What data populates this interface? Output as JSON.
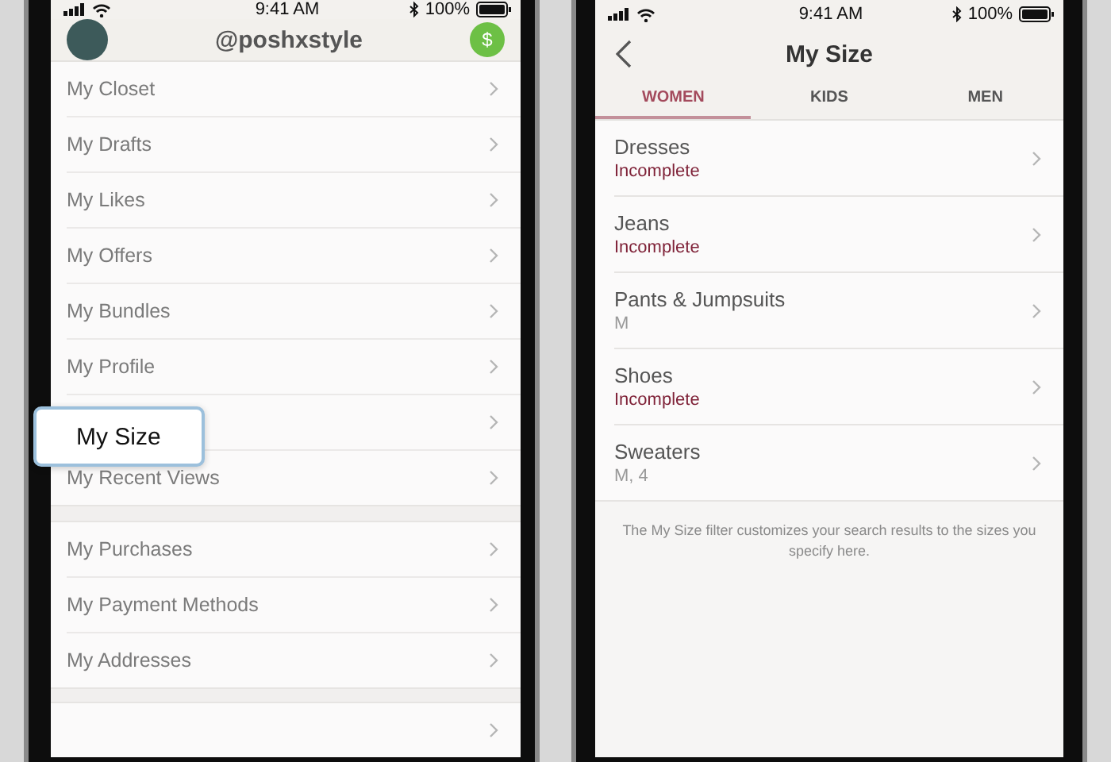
{
  "left_phone": {
    "status_bar": {
      "time": "9:41 AM",
      "battery": "100%"
    },
    "header": {
      "username": "@poshxstyle",
      "balance_icon": "$"
    },
    "sections": [
      {
        "items": [
          {
            "kind": "link",
            "label": "My Closet"
          },
          {
            "kind": "link",
            "label": "My Drafts"
          },
          {
            "kind": "link",
            "label": "My Likes"
          },
          {
            "kind": "link",
            "label": "My Offers"
          },
          {
            "kind": "link",
            "label": "My Bundles"
          },
          {
            "kind": "link",
            "label": "My Profile"
          },
          {
            "kind": "link"
          },
          {
            "kind": "link",
            "label": "My Recent Views"
          }
        ]
      },
      {
        "items": [
          {
            "kind": "link",
            "label": "My Purchases"
          },
          {
            "kind": "link",
            "label": "My Payment Methods"
          },
          {
            "kind": "link",
            "label": "My Addresses"
          }
        ]
      },
      {
        "items": [
          {
            "kind": "link"
          }
        ]
      }
    ],
    "callout": {
      "label": "My Size"
    }
  },
  "right_phone": {
    "status_bar": {
      "time": "9:41 AM",
      "battery": "100%"
    },
    "title": "My Size",
    "tabs": [
      {
        "label": "WOMEN",
        "selected": true
      },
      {
        "label": "KIDS",
        "selected": false
      },
      {
        "label": "MEN",
        "selected": false
      }
    ],
    "rows": [
      {
        "name": "Dresses",
        "value": "Incomplete",
        "incomplete": true
      },
      {
        "name": "Jeans",
        "value": "Incomplete",
        "incomplete": true
      },
      {
        "name": "Pants & Jumpsuits",
        "value": "M",
        "incomplete": false
      },
      {
        "name": "Shoes",
        "value": "Incomplete",
        "incomplete": true
      },
      {
        "name": "Sweaters",
        "value": "M, 4",
        "incomplete": false
      }
    ],
    "footnote": "The My Size filter customizes your search results to the sizes you specify here."
  }
}
